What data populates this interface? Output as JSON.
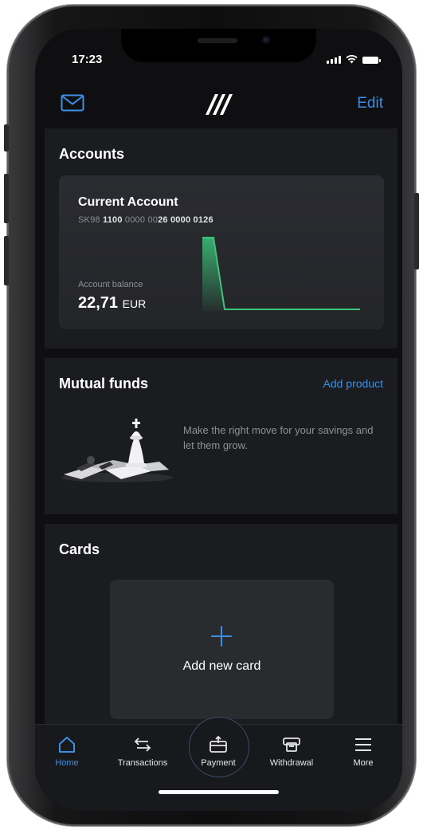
{
  "status": {
    "time": "17:23"
  },
  "header": {
    "edit_label": "Edit"
  },
  "accounts": {
    "title": "Accounts",
    "card": {
      "name": "Current Account",
      "iban_prefix": "SK98",
      "iban_bold1": "1100",
      "iban_mid": "0000 00",
      "iban_bold2": "26 0000 0126",
      "balance_label": "Account balance",
      "balance_value": "22,71",
      "balance_currency": "EUR"
    }
  },
  "funds": {
    "title": "Mutual funds",
    "add_product_label": "Add product",
    "description": "Make the right move for your savings and let them grow."
  },
  "cards": {
    "title": "Cards",
    "add_card_label": "Add new card"
  },
  "tabs": [
    {
      "label": "Home",
      "icon": "home-icon",
      "active": true
    },
    {
      "label": "Transactions",
      "icon": "transfer-arrows-icon"
    },
    {
      "label": "Payment",
      "icon": "payment-icon"
    },
    {
      "label": "Withdrawal",
      "icon": "atm-icon"
    },
    {
      "label": "More",
      "icon": "menu-icon"
    }
  ],
  "colors": {
    "accent": "#3d8fe4",
    "background": "#0f0f11",
    "panel": "#1b1c1f",
    "chart": "#3cc47a"
  }
}
